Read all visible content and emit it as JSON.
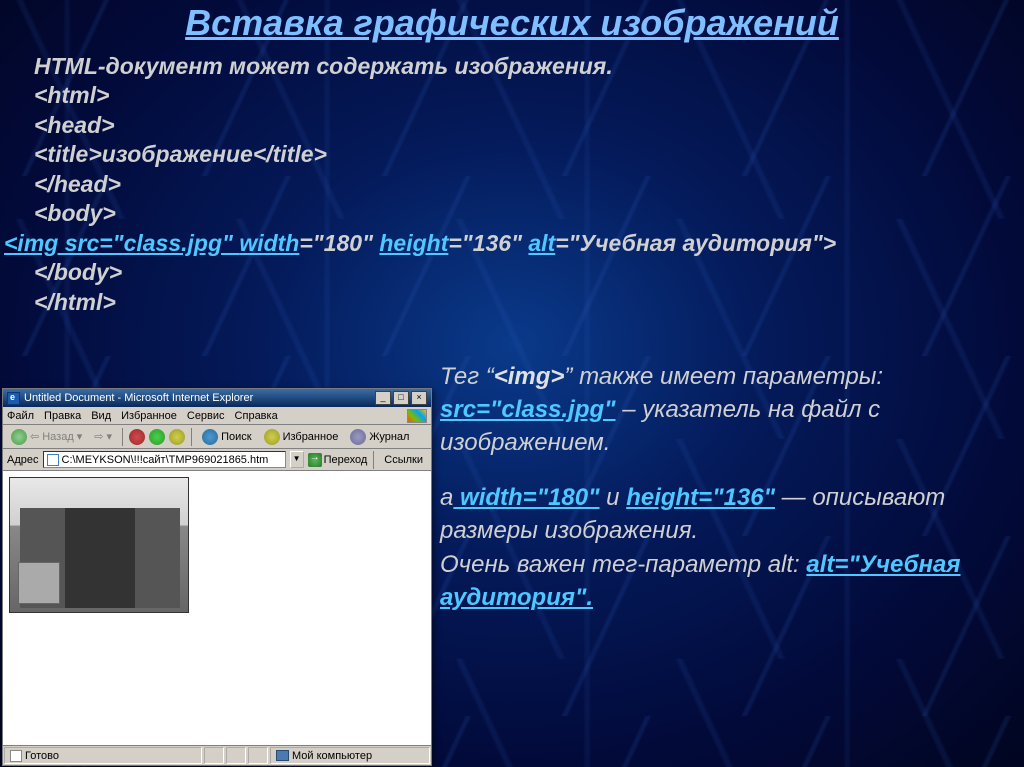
{
  "title": "Вставка графических изображений",
  "code": {
    "intro": "HTML-документ может содержать изображения.",
    "l1": "<html>",
    "l2": "<head>",
    "l3": "<title>изображение</title>",
    "l4": "</head>",
    "l5": "<body>",
    "img_pre": "<img src=\"class.jpg\" ",
    "img_w": "width",
    "img_wv": "=\"180\" ",
    "img_h": "height",
    "img_hv": "=\"136\" ",
    "img_a": "alt",
    "img_av": "=\"Учебная аудитория\">",
    "l7": "</body>",
    "l8": "</html>"
  },
  "desc": {
    "p1a": "Тег “",
    "p1b": "<img>",
    "p1c": "” также имеет параметры: ",
    "p1d": "src=\"class.jpg\"",
    "p1e": " – указатель на файл с изображением.",
    "p2a": "а",
    "p2b": " width=\"180\"",
    "p2c": " и ",
    "p2d": "height=\"136\"",
    "p2e": " — описывают размеры изображения.",
    "p3a": "Очень важен тег-параметр alt: ",
    "p3b": "alt=\"Учебная аудитория\"."
  },
  "browser": {
    "title": "Untitled Document - Microsoft Internet Explorer",
    "menu": {
      "file": "Файл",
      "edit": "Правка",
      "view": "Вид",
      "fav": "Избранное",
      "tools": "Сервис",
      "help": "Справка"
    },
    "toolbar": {
      "back": "Назад",
      "search": "Поиск",
      "fav": "Избранное",
      "journal": "Журнал"
    },
    "addr": {
      "label": "Адрес",
      "value": "C:\\MEYKSON\\!!!сайт\\TMP969021865.htm",
      "go": "Переход",
      "links": "Ссылки"
    },
    "status": {
      "ready": "Готово",
      "zone": "Мой компьютер"
    }
  }
}
